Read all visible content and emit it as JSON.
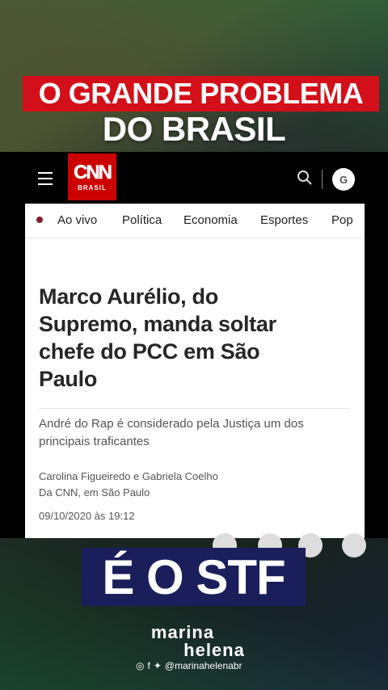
{
  "overlay": {
    "headline_line1": "O GRANDE PROBLEMA",
    "headline_line2": "DO BRASIL",
    "bottom_text": "É O STF"
  },
  "cnn_header": {
    "logo_text": "CNN",
    "logo_sub": "BRASIL",
    "google_label": "G"
  },
  "nav": {
    "items": [
      "Ao vivo",
      "Política",
      "Economia",
      "Esportes",
      "Pop"
    ]
  },
  "article": {
    "title": "Marco Aurélio, do Supremo, manda soltar chefe do PCC em São Paulo",
    "summary": "André do Rap é considerado pela Justiça um dos principais traficantes",
    "authors": "Carolina Figueiredo e Gabriela Coelho",
    "location": "Da CNN, em São Paulo",
    "date": "09/10/2020 às 19:12"
  },
  "brand": {
    "line1": "marina",
    "line2": "helena",
    "handle": "@marinahelenabr",
    "social_icons": [
      "instagram-icon",
      "facebook-icon",
      "twitter-icon"
    ]
  },
  "colors": {
    "headline_red": "#d3101a",
    "cnn_red": "#cc0000",
    "stf_box": "#1a1f5c"
  }
}
